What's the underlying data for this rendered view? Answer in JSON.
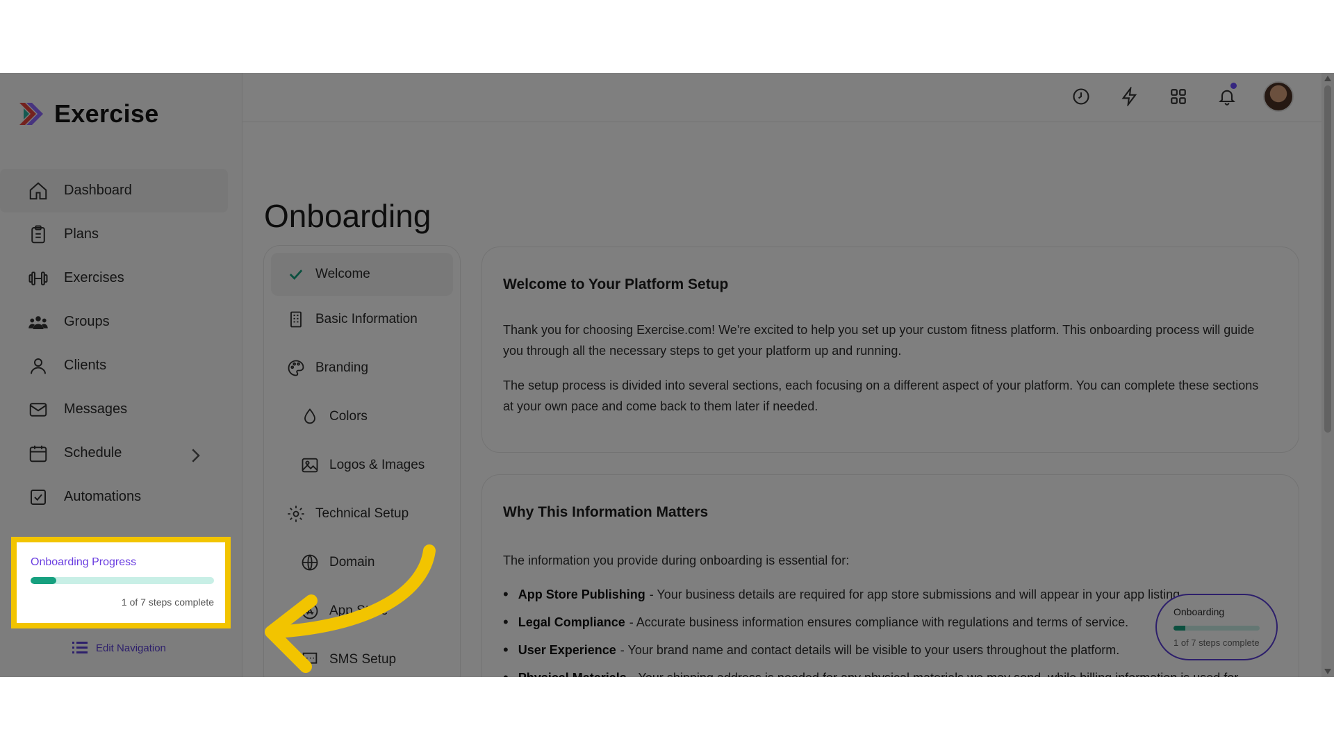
{
  "app": {
    "name": "Exercise"
  },
  "sidebar": {
    "items": [
      {
        "label": "Dashboard",
        "icon": "home-icon"
      },
      {
        "label": "Plans",
        "icon": "clipboard-icon"
      },
      {
        "label": "Exercises",
        "icon": "dumbbell-icon"
      },
      {
        "label": "Groups",
        "icon": "users-icon"
      },
      {
        "label": "Clients",
        "icon": "user-icon"
      },
      {
        "label": "Messages",
        "icon": "mail-icon"
      },
      {
        "label": "Schedule",
        "icon": "calendar-icon"
      },
      {
        "label": "Automations",
        "icon": "checkbox-icon"
      }
    ],
    "progress": {
      "title": "Onboarding Progress",
      "steps": "1 of 7 steps complete",
      "fraction": 0.14
    },
    "edit_nav": "Edit Navigation"
  },
  "header": {
    "icons": [
      "clock-icon",
      "bolt-icon",
      "grid-icon",
      "bell-icon",
      "avatar"
    ]
  },
  "page": {
    "title": "Onboarding"
  },
  "steps": [
    {
      "label": "Welcome",
      "icon": "check-icon",
      "completed": true
    },
    {
      "label": "Basic Information",
      "icon": "building-icon"
    },
    {
      "label": "Branding",
      "icon": "palette-icon"
    },
    {
      "label": "Colors",
      "icon": "droplet-icon"
    },
    {
      "label": "Logos & Images",
      "icon": "image-icon"
    },
    {
      "label": "Technical Setup",
      "icon": "gear-icon"
    },
    {
      "label": "Domain",
      "icon": "globe-icon"
    },
    {
      "label": "App Store",
      "icon": "appstore-icon"
    },
    {
      "label": "SMS Setup",
      "icon": "chat-icon"
    }
  ],
  "welcome_card": {
    "title": "Welcome to Your Platform Setup",
    "p1": "Thank you for choosing Exercise.com! We're excited to help you set up your custom fitness platform. This onboarding process will guide you through all the necessary steps to get your platform up and running.",
    "p2": "The setup process is divided into several sections, each focusing on a different aspect of your platform. You can complete these sections at your own pace and come back to them later if needed."
  },
  "why_card": {
    "title": "Why This Information Matters",
    "intro": "The information you provide during onboarding is essential for:",
    "bullets": [
      {
        "term": "App Store Publishing",
        "text": "- Your business details are required for app store submissions and will appear in your app listing."
      },
      {
        "term": "Legal Compliance",
        "text": "- Accurate business information ensures compliance with regulations and terms of service."
      },
      {
        "term": "User Experience",
        "text": "- Your brand name and contact details will be visible to your users throughout the platform."
      },
      {
        "term": "Physical Materials",
        "text": "- Your shipping address is needed for any physical materials we may send, while billing information is used for"
      }
    ]
  },
  "mini_progress": {
    "title": "Onboarding",
    "steps": "1 of 7 steps complete",
    "fraction": 0.14
  },
  "colors": {
    "accent": "#6a3ee0",
    "progress": "#16a07f",
    "highlight": "#f2c400"
  }
}
